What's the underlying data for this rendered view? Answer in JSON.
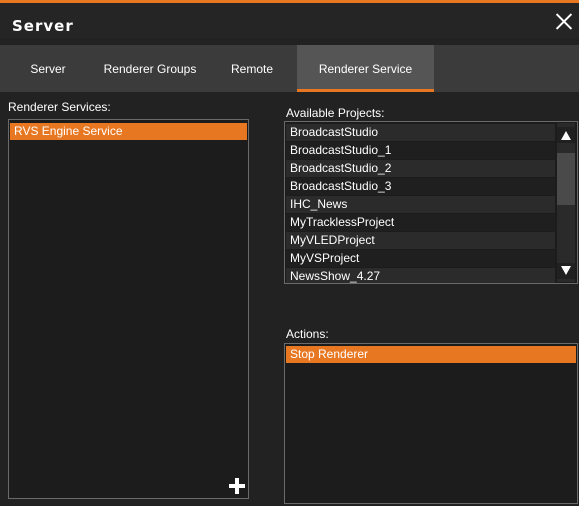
{
  "window": {
    "title": "Server",
    "close_icon": "close-icon"
  },
  "tabs": [
    {
      "label": "Server",
      "active": false
    },
    {
      "label": "Renderer Groups",
      "active": false
    },
    {
      "label": "Remote",
      "active": false
    },
    {
      "label": "Renderer Service",
      "active": true
    }
  ],
  "renderer_services": {
    "label": "Renderer Services:",
    "items": [
      "RVS Engine Service"
    ],
    "selected_index": 0,
    "add_icon": "plus-icon"
  },
  "available_projects": {
    "label": "Available Projects:",
    "items": [
      "BroadcastStudio",
      "BroadcastStudio_1",
      "BroadcastStudio_2",
      "BroadcastStudio_3",
      "IHC_News",
      "MyTracklessProject",
      "MyVLEDProject",
      "MyVSProject",
      "NewsShow_4.27"
    ],
    "scroll_up_icon": "triangle-up-icon",
    "scroll_down_icon": "triangle-down-icon"
  },
  "actions": {
    "label": "Actions:",
    "items": [
      "Stop Renderer"
    ],
    "selected_index": 0
  },
  "colors": {
    "accent": "#e87722",
    "background": "#222222",
    "tab_bar": "#3b3b3b"
  }
}
